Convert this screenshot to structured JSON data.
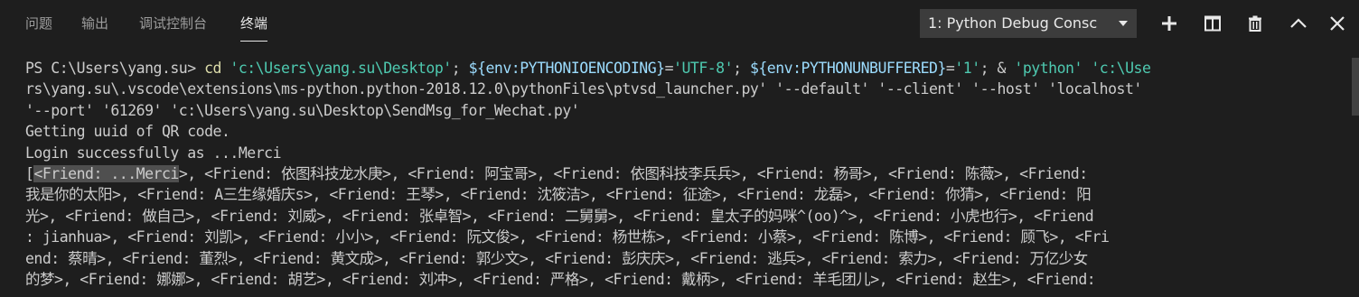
{
  "tabs": [
    {
      "label": "问题"
    },
    {
      "label": "输出"
    },
    {
      "label": "调试控制台"
    },
    {
      "label": "终端"
    }
  ],
  "terminal_selector": {
    "value": "1: Python Debug Consc"
  },
  "actions": {
    "new_terminal": "plus-icon",
    "split_terminal": "split-icon",
    "kill_terminal": "trash-icon",
    "maximize": "chevron-up-icon",
    "close": "close-icon"
  },
  "terminal": {
    "line1": {
      "prompt": "PS C:\\Users\\yang.su> ",
      "cmd": "cd",
      "arg1": " 'c:\\Users\\yang.su\\Desktop'",
      "sep1": "; ",
      "env1": "${env:PYTHONIOENCODING}",
      "eq1": "=",
      "val1": "'UTF-8'",
      "sep2": "; ",
      "env2": "${env:PYTHONUNBUFFERED}",
      "eq2": "=",
      "val2": "'1'",
      "sep3": "; & ",
      "py": "'python'",
      "sp": " ",
      "path_start": "'c:\\Use"
    },
    "line2": "rs\\yang.su\\.vscode\\extensions\\ms-python.python-2018.12.0\\pythonFiles\\ptvsd_launcher.py' '--default' '--client' '--host' 'localhost'",
    "line3": "'--port' '61269' 'c:\\Users\\yang.su\\Desktop\\SendMsg_for_Wechat.py'",
    "line4": "Getting uuid of QR code.",
    "line5": "Login successfully as ...Merci",
    "line6_open": "[",
    "line6_sel": "<Friend: ...Merci",
    "line6_rest": ">, <Friend: 依图科技龙水庚>, <Friend: 阿宝哥>, <Friend: 依图科技李兵兵>, <Friend: 杨哥>, <Friend: 陈薇>, <Friend:",
    "line7": "我是你的太阳>, <Friend: A三生缘婚庆s>, <Friend: 王琴>, <Friend: 沈筱洁>, <Friend: 征途>, <Friend: 龙磊>, <Friend: 你猜>, <Friend: 阳",
    "line8": "光>, <Friend: 做自己>, <Friend: 刘威>, <Friend: 张卓智>, <Friend: 二舅舅>, <Friend: 皇太子的妈咪^(oo)^>, <Friend: 小虎也行>, <Friend",
    "line9": ": jianhua>, <Friend: 刘凯>, <Friend: 小小>, <Friend: 阮文俊>, <Friend: 杨世栋>, <Friend: 小蔡>, <Friend: 陈博>, <Friend: 顾飞>, <Fri",
    "line10": "end: 蔡晴>, <Friend: 董烈>, <Friend: 黄文成>, <Friend: 郭少文>, <Friend: 彭庆庆>, <Friend: 逃兵>, <Friend: 索力>, <Friend: 万亿少女",
    "line11": "的梦>, <Friend: 娜娜>, <Friend: 胡艺>, <Friend: 刘冲>, <Friend: 严格>, <Friend: 戴柄>, <Friend: 羊毛团儿>, <Friend: 赵生>, <Friend:"
  },
  "colors": {
    "background": "#1e1e1e",
    "text": "#cccccc",
    "command": "#dcdcaa",
    "string": "#4ec9b0",
    "variable": "#9cdcfe",
    "selection": "#4f4f4f",
    "select_bg": "#3c3c3c"
  }
}
